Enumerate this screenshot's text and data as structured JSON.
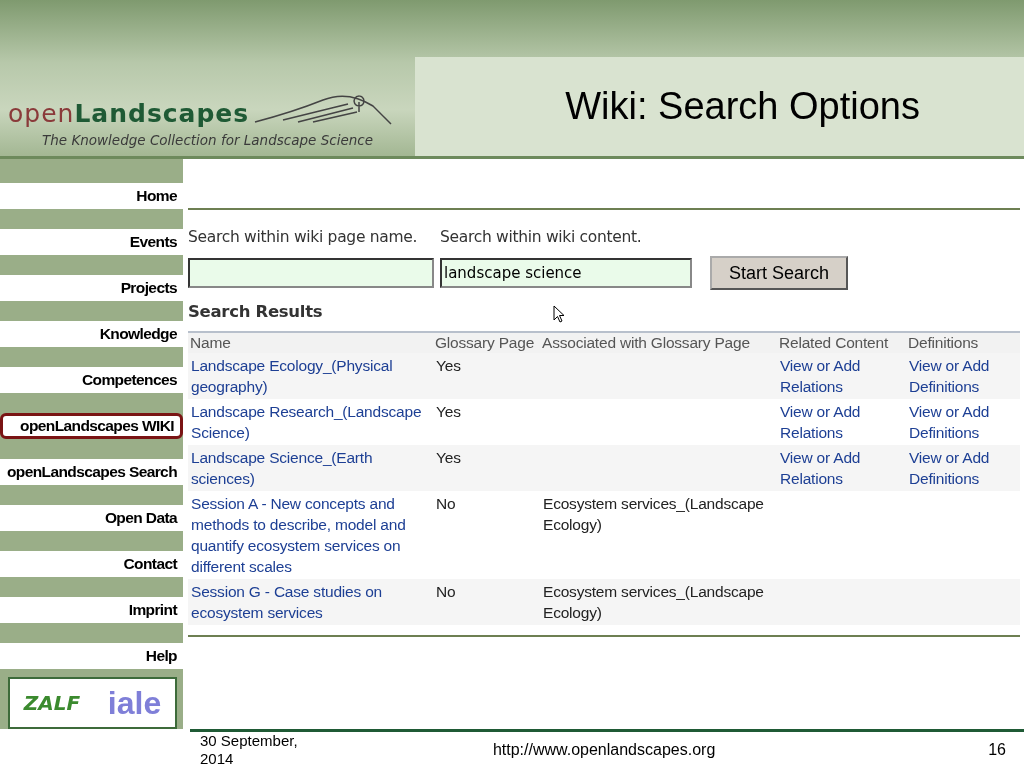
{
  "header": {
    "brand_light": "open",
    "brand_bold": "Landscapes",
    "tagline": "The Knowledge Collection for Landscape Science",
    "slide_title": "Wiki: Search Options"
  },
  "sidebar": {
    "items": [
      {
        "label": "Home",
        "selected": false
      },
      {
        "label": "Events",
        "selected": false
      },
      {
        "label": "Projects",
        "selected": false
      },
      {
        "label": "Knowledge",
        "selected": false
      },
      {
        "label": "Competences",
        "selected": false
      },
      {
        "label": "openLandscapes WIKI",
        "selected": true
      },
      {
        "label": "openLandscapes Search",
        "selected": false
      },
      {
        "label": "Open Data",
        "selected": false
      },
      {
        "label": "Contact",
        "selected": false
      },
      {
        "label": "Imprint",
        "selected": false
      },
      {
        "label": "Help",
        "selected": false
      }
    ],
    "logos": {
      "left": "ZALF",
      "right": "iale"
    }
  },
  "search": {
    "name_label": "Search within wiki page name.",
    "content_label": "Search within wiki content.",
    "content_value": "landscape science",
    "button": "Start Search"
  },
  "results": {
    "title": "Search Results",
    "columns": [
      "Name",
      "Glossary Page",
      "Associated with Glossary Page",
      "Related Content",
      "Definitions"
    ],
    "rows": [
      {
        "name": "Landscape Ecology_(Physical geography)",
        "glossary": "Yes",
        "related": "View or Add Relations",
        "definitions": "View or Add Definitions"
      },
      {
        "name": "Landscape Research_(Landscape Science)",
        "glossary": "Yes",
        "related": "View or Add Relations",
        "definitions": "View or Add Definitions"
      },
      {
        "name": "Landscape Science_(Earth sciences)",
        "glossary": "Yes",
        "related": "View or Add Relations",
        "definitions": "View or Add Definitions"
      },
      {
        "name": "Session A - New concepts and methods to describe, model and quantify ecosystem services on different scales",
        "glossary": "No",
        "associated": "Ecosystem services_(Landscape Ecology)"
      },
      {
        "name": "Session G - Case studies on ecosystem services",
        "glossary": "No",
        "associated": "Ecosystem services_(Landscape Ecology)"
      }
    ]
  },
  "footer": {
    "date": "30 September, 2014",
    "url": "http://www.openlandscapes.org",
    "page": "16"
  }
}
